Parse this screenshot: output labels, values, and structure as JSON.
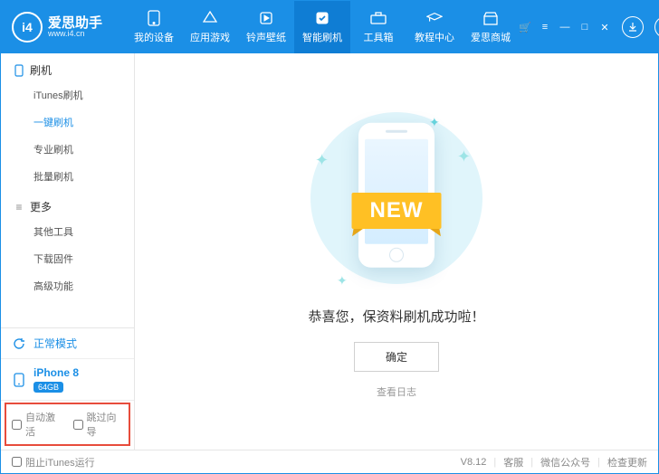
{
  "app": {
    "name": "爱思助手",
    "sub": "www.i4.cn",
    "logo_text": "i4"
  },
  "nav": [
    {
      "id": "device",
      "label": "我的设备"
    },
    {
      "id": "games",
      "label": "应用游戏"
    },
    {
      "id": "ringtone",
      "label": "铃声壁纸"
    },
    {
      "id": "flash",
      "label": "智能刷机",
      "active": true
    },
    {
      "id": "tools",
      "label": "工具箱"
    },
    {
      "id": "tutorial",
      "label": "教程中心"
    },
    {
      "id": "store",
      "label": "爱思商城"
    }
  ],
  "sidebar": {
    "flash": {
      "header": "刷机",
      "items": [
        {
          "label": "iTunes刷机"
        },
        {
          "label": "一键刷机",
          "active": true
        },
        {
          "label": "专业刷机"
        },
        {
          "label": "批量刷机"
        }
      ]
    },
    "more": {
      "header": "更多",
      "items": [
        {
          "label": "其他工具"
        },
        {
          "label": "下载固件"
        },
        {
          "label": "高级功能"
        }
      ]
    },
    "mode": "正常模式",
    "device": {
      "name": "iPhone 8",
      "badge": "64GB"
    },
    "checks": {
      "auto_activate": "自动激活",
      "skip_guide": "跳过向导"
    }
  },
  "main": {
    "ribbon": "NEW",
    "message": "恭喜您，保资料刷机成功啦！",
    "ok": "确定",
    "log": "查看日志"
  },
  "status": {
    "block_itunes": "阻止iTunes运行",
    "version": "V8.12",
    "support": "客服",
    "wechat": "微信公众号",
    "update": "检查更新"
  }
}
